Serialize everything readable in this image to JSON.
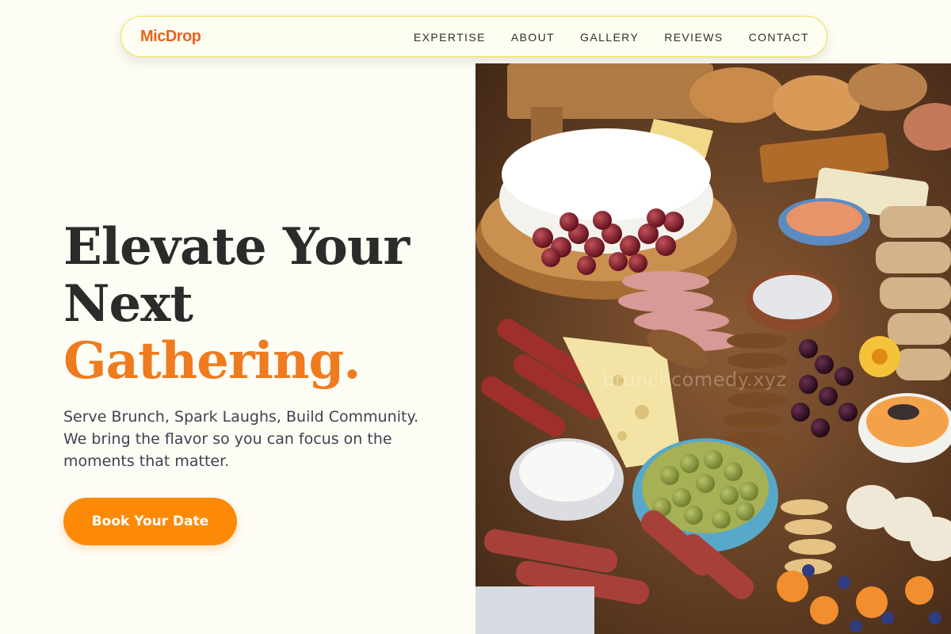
{
  "brand": {
    "name": "MicDrop",
    "color": "#e9641e"
  },
  "nav": {
    "items": [
      {
        "label": "EXPERTISE"
      },
      {
        "label": "ABOUT"
      },
      {
        "label": "GALLERY"
      },
      {
        "label": "REVIEWS"
      },
      {
        "label": "CONTACT"
      }
    ]
  },
  "hero": {
    "title_line1": "Elevate Your",
    "title_line2": "Next",
    "title_accent": "Gathering.",
    "subtitle": "Serve Brunch, Spark Laughs, Build Community. We bring the flavor so you can focus on the moments that matter.",
    "cta_label": "Book Your Date",
    "image_watermark": "brunchcomedy.xyz"
  },
  "colors": {
    "background": "#fdfcf5",
    "accent_orange": "#f07b1f",
    "cta_orange": "#fd8a07",
    "nav_border": "#f2e14a",
    "title": "#2b2b2b",
    "body_text": "#3d4350"
  },
  "image": {
    "semantic": "charcuterie-board-photo"
  }
}
